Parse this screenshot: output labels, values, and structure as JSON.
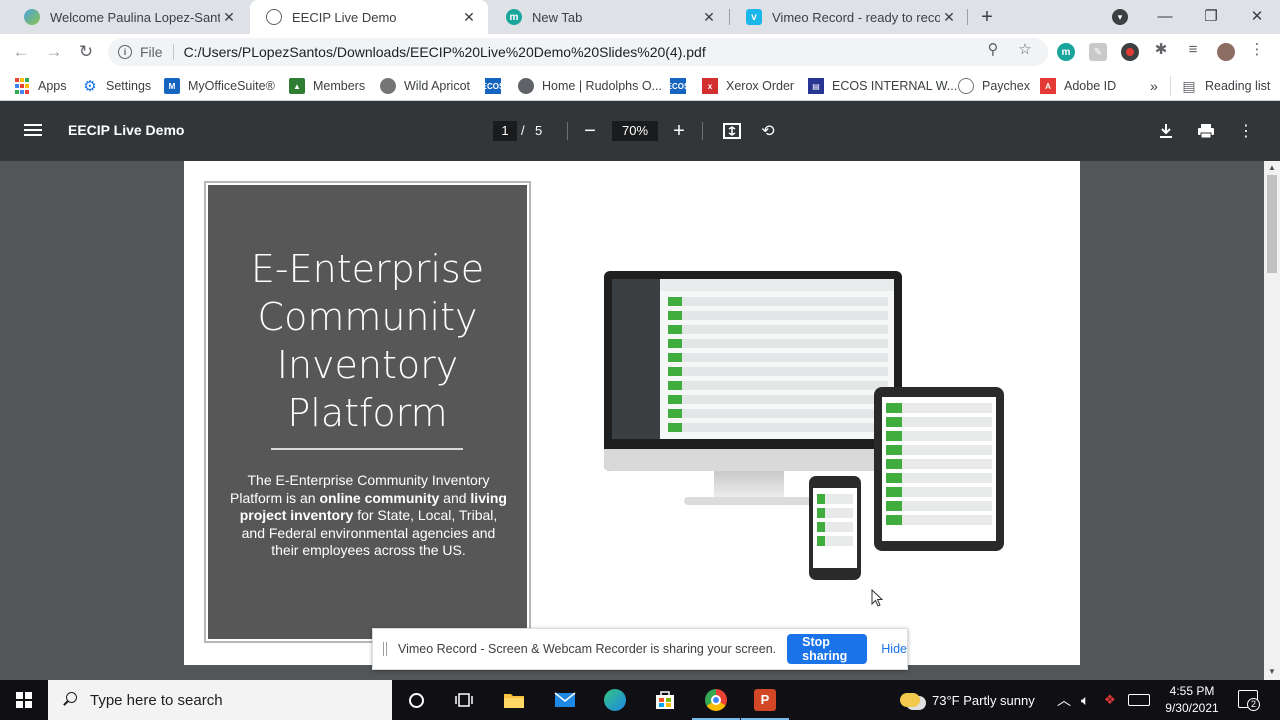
{
  "browser": {
    "tabs": [
      {
        "title": "Welcome Paulina Lopez-Santos!",
        "icon": "eecip-globe-icon",
        "active": false
      },
      {
        "title": "EECIP Live Demo",
        "icon": "globe-icon",
        "active": true
      },
      {
        "title": "New Tab",
        "icon": "myofficesuite-icon",
        "active": false
      },
      {
        "title": "Vimeo Record - ready to record",
        "icon": "vimeo-icon",
        "active": false
      }
    ],
    "address": {
      "scheme": "File",
      "url": "C:/Users/PLopezSantos/Downloads/EECIP%20Live%20Demo%20Slides%20(4).pdf"
    },
    "bookmarks": [
      {
        "label": "Apps",
        "icon": "apps-grid-icon"
      },
      {
        "label": "Settings",
        "icon": "gear-icon"
      },
      {
        "label": "MyOfficeSuite®",
        "icon": "myofficesuite-icon"
      },
      {
        "label": "Members",
        "icon": "members-icon"
      },
      {
        "label": "Wild Apricot",
        "icon": "globe-icon"
      },
      {
        "label": "",
        "icon": "ecos-icon"
      },
      {
        "label": "Home | Rudolphs O...",
        "icon": "globe-icon"
      },
      {
        "label": "",
        "icon": "ecos-icon"
      },
      {
        "label": "Xerox Order",
        "icon": "xerox-icon"
      },
      {
        "label": "ECOS INTERNAL W...",
        "icon": "ecos-internal-icon"
      },
      {
        "label": "Paychex",
        "icon": "paychex-icon"
      },
      {
        "label": "Adobe ID",
        "icon": "adobe-icon"
      }
    ],
    "bookmarks_overflow": "»",
    "reading_list": "Reading list"
  },
  "pdf": {
    "title": "EECIP Live Demo",
    "page_current": "1",
    "page_separator": "/",
    "page_total": "5",
    "zoom": "70%",
    "slide": {
      "title_lines": [
        "E-Enterprise",
        "Community",
        "Inventory",
        "Platform"
      ],
      "desc": {
        "p1": "The E-Enterprise Community Inventory Platform is an ",
        "b1": "online community",
        "p2": " and ",
        "b2": "living project inventory",
        "p3": " for State, Local, Tribal, and Federal environmental agencies and their employees across the US."
      }
    }
  },
  "share_bar": {
    "message": "Vimeo Record - Screen & Webcam Recorder is sharing your screen.",
    "stop_label": "Stop sharing",
    "hide_label": "Hide"
  },
  "taskbar": {
    "search_placeholder": "Type here to search",
    "weather": "73°F  Partly sunny",
    "time": "4:55 PM",
    "date": "9/30/2021",
    "notification_count": "2"
  },
  "colors": {
    "accent": "#1a73e8",
    "pdf_toolbar": "#323639",
    "viewer_bg": "#525659",
    "slide_panel": "#575757",
    "green": "#3fae3f"
  }
}
